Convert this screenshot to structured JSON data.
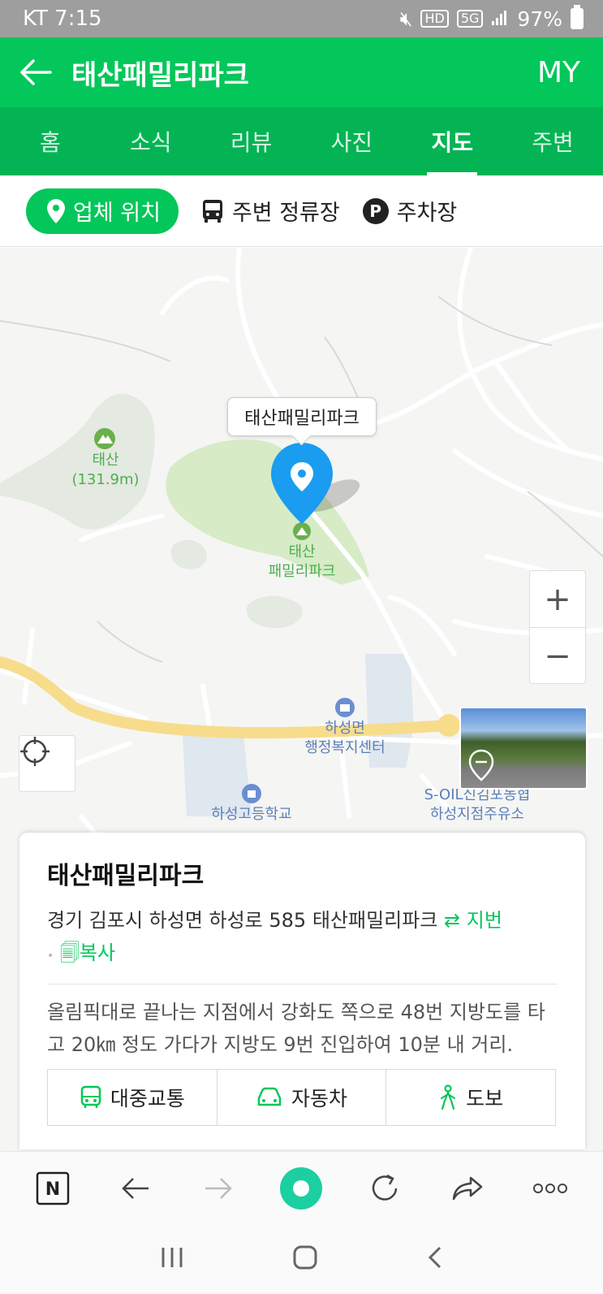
{
  "status_bar": {
    "carrier_time": "KT 7:15",
    "battery": "97%",
    "icons": [
      "mute-icon",
      "hd-icon",
      "5g-icon",
      "signal-icon",
      "battery-icon"
    ]
  },
  "header": {
    "title": "태산패밀리파크",
    "my_label": "MY"
  },
  "tabs": [
    {
      "label": "홈",
      "active": false
    },
    {
      "label": "소식",
      "active": false
    },
    {
      "label": "리뷰",
      "active": false
    },
    {
      "label": "사진",
      "active": false
    },
    {
      "label": "지도",
      "active": true
    },
    {
      "label": "주변",
      "active": false
    }
  ],
  "filters": [
    {
      "label": "업체 위치",
      "icon": "location-pin-icon",
      "active": true
    },
    {
      "label": "주변 정류장",
      "icon": "bus-icon",
      "active": false
    },
    {
      "label": "주차장",
      "icon": "parking-icon",
      "active": false
    }
  ],
  "map": {
    "callout": "태산패밀리파크",
    "labels": {
      "mountain_name": "태산",
      "mountain_height": "(131.9m)",
      "park_line1": "태산",
      "park_line2": "패밀리파크",
      "office_line1": "하성면",
      "office_line2": "행정복지센터",
      "gas_line1": "S-OIL신김포농협",
      "gas_line2": "하성지점주유소",
      "school": "하성고등학교"
    },
    "zoom_in": "+",
    "zoom_out": "−"
  },
  "card": {
    "name": "태산패밀리파크",
    "address": "경기 김포시 하성면 하성로 585 태산패밀리파크",
    "jibun_label": "지번",
    "copy_label": "복사",
    "description": "올림픽대로 끝나는 지점에서 강화도 쪽으로 48번 지방도를 타고 20㎞ 정도 가다가 지방도 9번 진입하여 10분 내 거리.",
    "transport": [
      {
        "label": "대중교통",
        "icon": "bus-outline-icon"
      },
      {
        "label": "자동차",
        "icon": "car-icon"
      },
      {
        "label": "도보",
        "icon": "walk-icon"
      }
    ]
  },
  "colors": {
    "brand_green": "#03c75a",
    "tab_green": "#04b454",
    "pin_blue": "#1a9cf0"
  }
}
